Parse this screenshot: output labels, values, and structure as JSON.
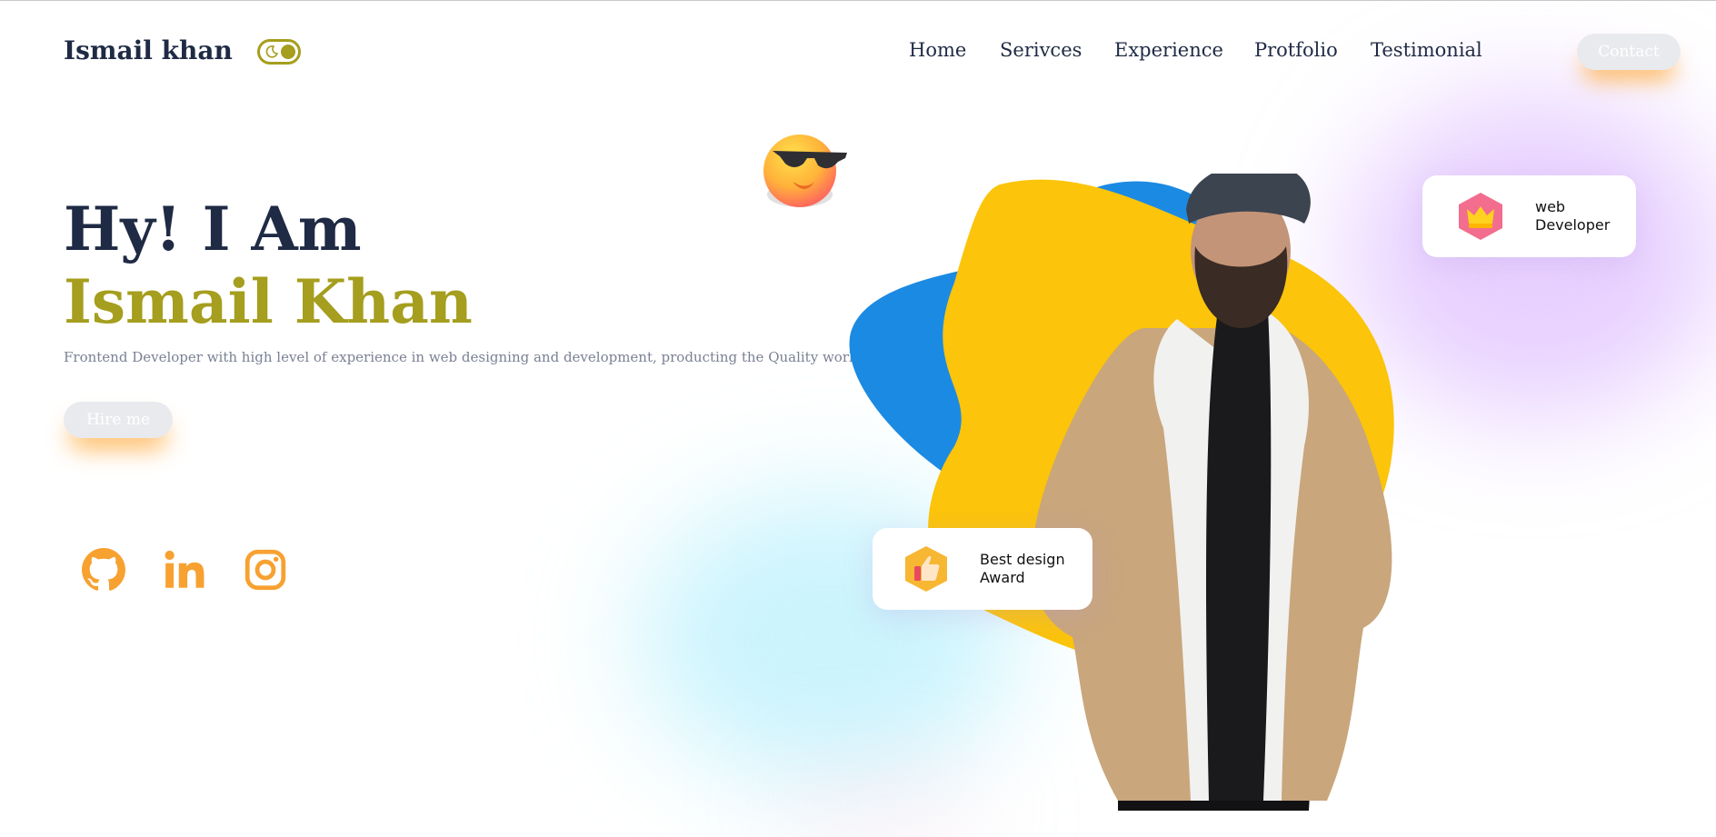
{
  "header": {
    "logo": "Ismail khan",
    "nav": [
      "Home",
      "Serivces",
      "Experience",
      "Protfolio",
      "Testimonial"
    ],
    "contact_label": "Contact"
  },
  "hero": {
    "greeting": "Hy! I Am",
    "name": "Ismail Khan",
    "description": "Frontend Developer with high level of experience in web designing and development, producting the Quality work",
    "hire_label": "Hire me"
  },
  "cards": {
    "web_line1": "web",
    "web_line2": "Developer",
    "award_line1": "Best design",
    "award_line2": "Award"
  },
  "colors": {
    "accent": "#a59e1e",
    "dark": "#1f2a44",
    "orange": "#f7a131",
    "yellow_blob": "#fcc40a",
    "blue_blob": "#1b8ae3"
  },
  "icons": [
    "moon-icon",
    "github-icon",
    "linkedin-icon",
    "instagram-icon",
    "crown-icon",
    "thumbs-up-icon",
    "sunglasses-emoji"
  ]
}
